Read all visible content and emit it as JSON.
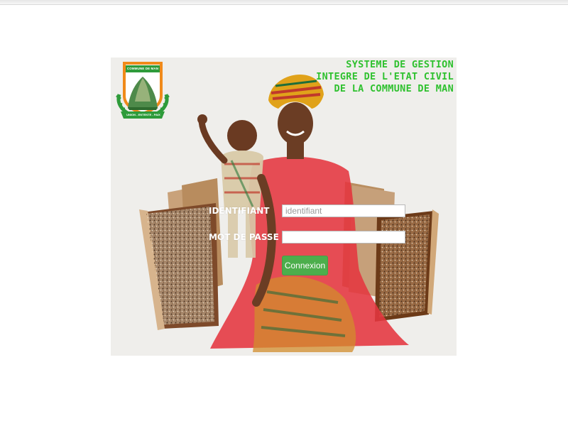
{
  "header": {
    "title_lines": [
      "SYSTEME DE GESTION",
      "INTEGRE DE L'ETAT CIVIL",
      "DE LA COMMUNE DE MAN"
    ],
    "title_color": "#2fc12f"
  },
  "logo": {
    "banner": "COMMUNE DE MAN",
    "motto": "UNION - ENTENTE - PAIX",
    "colors": {
      "orange": "#f08a1a",
      "green": "#2e9b3a",
      "white": "#ffffff"
    }
  },
  "login": {
    "username_label": "IDENTIFIANT",
    "username_placeholder": "identifiant",
    "username_value": "",
    "password_label": "MOT DE PASSE",
    "password_value": "",
    "submit_label": "Connexion",
    "submit_color": "#4cae4c"
  }
}
